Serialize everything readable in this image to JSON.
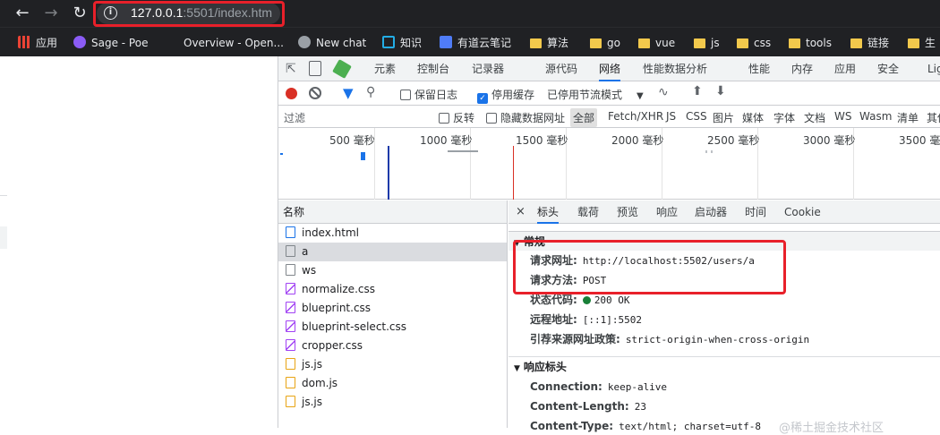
{
  "browser": {
    "url_host": "127.0.0.1",
    "url_path": ":5501/index.htm"
  },
  "bookmarks": [
    {
      "label": "应用",
      "icon": "apps-grid-icon"
    },
    {
      "label": "Sage - Poe",
      "icon": "poe-icon"
    },
    {
      "label": "Overview - Open...",
      "icon": "openai-icon"
    },
    {
      "label": "New chat",
      "icon": "chatgpt-icon"
    },
    {
      "label": "知识",
      "icon": "bilibili-icon"
    },
    {
      "label": "有道云笔记",
      "icon": "youdao-icon"
    },
    {
      "label": "算法",
      "icon": "folder-icon"
    },
    {
      "label": "go",
      "icon": "folder-icon"
    },
    {
      "label": "vue",
      "icon": "folder-icon"
    },
    {
      "label": "js",
      "icon": "folder-icon"
    },
    {
      "label": "css",
      "icon": "folder-icon"
    },
    {
      "label": "tools",
      "icon": "folder-icon"
    },
    {
      "label": "链接",
      "icon": "folder-icon"
    },
    {
      "label": "生",
      "icon": "folder-icon"
    }
  ],
  "devtools": {
    "main_tabs": [
      "元素",
      "控制台",
      "记录器",
      "源代码",
      "网络",
      "性能数据分析",
      "性能",
      "内存",
      "应用",
      "安全",
      "Lig"
    ],
    "active_tab": "网络",
    "toolbar": {
      "preserve_log": "保留日志",
      "disable_cache": "停用缓存",
      "throttle": "已停用节流模式"
    },
    "filter": {
      "placeholder": "过滤",
      "invert": "反转",
      "hide_data_urls": "隐藏数据网址",
      "types": [
        "全部",
        "Fetch/XHR",
        "JS",
        "CSS",
        "图片",
        "媒体",
        "字体",
        "文档",
        "WS",
        "Wasm",
        "清单",
        "其他"
      ]
    },
    "timeline_ticks": [
      "500 毫秒",
      "1000 毫秒",
      "1500 毫秒",
      "2000 毫秒",
      "2500 毫秒",
      "3000 毫秒",
      "3500 毫秒"
    ],
    "list_header": "名称",
    "requests": [
      {
        "name": "index.html",
        "type": "doc"
      },
      {
        "name": "a",
        "type": "plain"
      },
      {
        "name": "ws",
        "type": "plain"
      },
      {
        "name": "normalize.css",
        "type": "css"
      },
      {
        "name": "blueprint.css",
        "type": "css"
      },
      {
        "name": "blueprint-select.css",
        "type": "css"
      },
      {
        "name": "cropper.css",
        "type": "css"
      },
      {
        "name": "js.js",
        "type": "js"
      },
      {
        "name": "dom.js",
        "type": "js"
      },
      {
        "name": "js.js",
        "type": "js"
      }
    ],
    "detail_tabs": [
      "标头",
      "载荷",
      "预览",
      "响应",
      "启动器",
      "时间",
      "Cookie"
    ],
    "general_section": "常规",
    "general": [
      {
        "k": "请求网址:",
        "v": "http://localhost:5502/users/a"
      },
      {
        "k": "请求方法:",
        "v": "POST"
      },
      {
        "k": "状态代码:",
        "v": "200 OK"
      },
      {
        "k": "远程地址:",
        "v": "[::1]:5502"
      },
      {
        "k": "引荐来源网址政策:",
        "v": "strict-origin-when-cross-origin"
      }
    ],
    "response_section": "响应标头",
    "response_headers": [
      {
        "k": "Connection:",
        "v": "keep-alive"
      },
      {
        "k": "Content-Length:",
        "v": "23"
      },
      {
        "k": "Content-Type:",
        "v": "text/html; charset=utf-8"
      }
    ],
    "watermark": "@稀土掘金技术社区"
  },
  "colors": {
    "highlight_box": "#e8202a",
    "accent": "#1a73e8",
    "status_ok": "#188038"
  }
}
